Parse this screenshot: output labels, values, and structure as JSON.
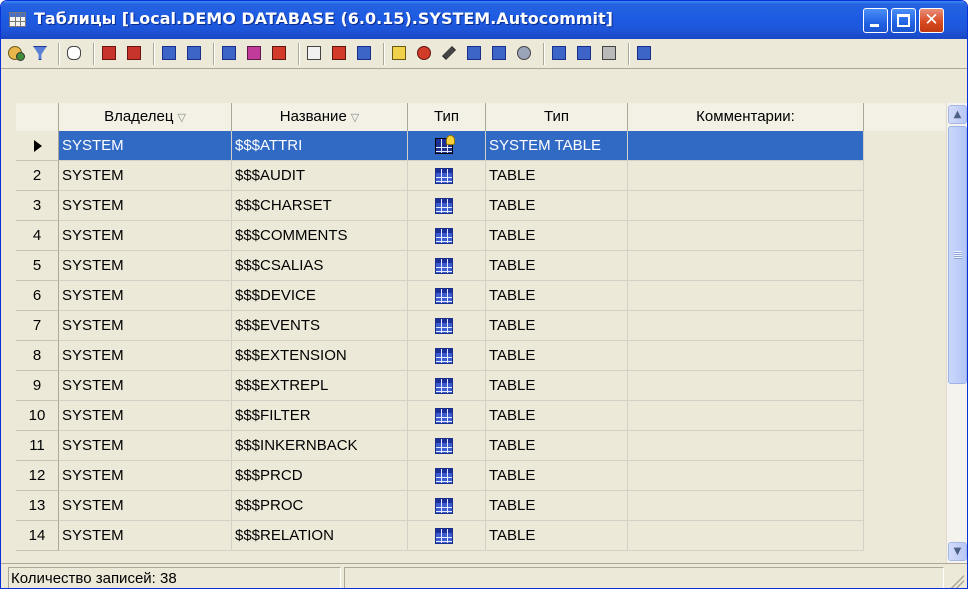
{
  "window": {
    "title": "Таблицы [Local.DEMO DATABASE (6.0.15).SYSTEM.Autocommit]"
  },
  "grid": {
    "columns": [
      {
        "label": "Владелец",
        "sortable": true
      },
      {
        "label": "Название",
        "sortable": true
      },
      {
        "label": "Тип",
        "sortable": false
      },
      {
        "label": "Тип",
        "sortable": false
      },
      {
        "label": "Комментарии:",
        "sortable": false
      }
    ],
    "sort_glyph": "▽",
    "rows": [
      {
        "num": "",
        "owner": "SYSTEM",
        "name": "$$$ATTRI",
        "type": "SYSTEM TABLE",
        "comment": "",
        "icon": "system-table-icon"
      },
      {
        "num": "2",
        "owner": "SYSTEM",
        "name": "$$$AUDIT",
        "type": "TABLE",
        "comment": "",
        "icon": "table-icon"
      },
      {
        "num": "3",
        "owner": "SYSTEM",
        "name": "$$$CHARSET",
        "type": "TABLE",
        "comment": "",
        "icon": "table-icon"
      },
      {
        "num": "4",
        "owner": "SYSTEM",
        "name": "$$$COMMENTS",
        "type": "TABLE",
        "comment": "",
        "icon": "table-icon"
      },
      {
        "num": "5",
        "owner": "SYSTEM",
        "name": "$$$CSALIAS",
        "type": "TABLE",
        "comment": "",
        "icon": "table-icon"
      },
      {
        "num": "6",
        "owner": "SYSTEM",
        "name": "$$$DEVICE",
        "type": "TABLE",
        "comment": "",
        "icon": "table-icon"
      },
      {
        "num": "7",
        "owner": "SYSTEM",
        "name": "$$$EVENTS",
        "type": "TABLE",
        "comment": "",
        "icon": "table-icon"
      },
      {
        "num": "8",
        "owner": "SYSTEM",
        "name": "$$$EXTENSION",
        "type": "TABLE",
        "comment": "",
        "icon": "table-icon"
      },
      {
        "num": "9",
        "owner": "SYSTEM",
        "name": "$$$EXTREPL",
        "type": "TABLE",
        "comment": "",
        "icon": "table-icon"
      },
      {
        "num": "10",
        "owner": "SYSTEM",
        "name": "$$$FILTER",
        "type": "TABLE",
        "comment": "",
        "icon": "table-icon"
      },
      {
        "num": "11",
        "owner": "SYSTEM",
        "name": "$$$INKERNBACK",
        "type": "TABLE",
        "comment": "",
        "icon": "table-icon"
      },
      {
        "num": "12",
        "owner": "SYSTEM",
        "name": "$$$PRCD",
        "type": "TABLE",
        "comment": "",
        "icon": "table-icon"
      },
      {
        "num": "13",
        "owner": "SYSTEM",
        "name": "$$$PROC",
        "type": "TABLE",
        "comment": "",
        "icon": "table-icon"
      },
      {
        "num": "14",
        "owner": "SYSTEM",
        "name": "$$$RELATION",
        "type": "TABLE",
        "comment": "",
        "icon": "table-icon"
      }
    ]
  },
  "status": {
    "record_count": "Количество записей: 38"
  },
  "colors": {
    "selection": "#316ac5",
    "titlebar": "#1d5be3",
    "chrome": "#ece9d8"
  }
}
